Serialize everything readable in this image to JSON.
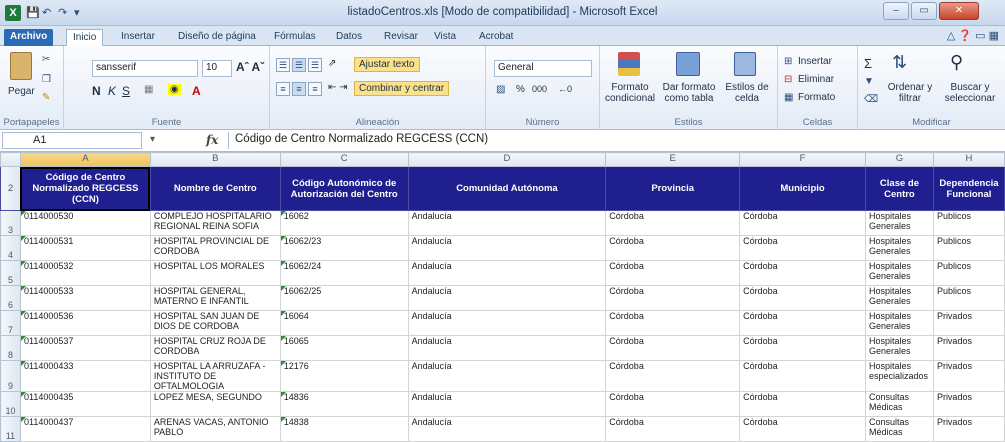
{
  "window": {
    "title": "listadoCentros.xls  [Modo de compatibilidad] - Microsoft Excel",
    "app_letter": "X",
    "controls": [
      "–",
      "▭",
      "✕"
    ]
  },
  "tabs": [
    {
      "label": "Archivo"
    },
    {
      "label": "Inicio"
    },
    {
      "label": "Insertar"
    },
    {
      "label": "Diseño de página"
    },
    {
      "label": "Fórmulas"
    },
    {
      "label": "Datos"
    },
    {
      "label": "Revisar"
    },
    {
      "label": "Vista"
    },
    {
      "label": "Acrobat"
    }
  ],
  "ribbon": {
    "clipboard": {
      "paste": "Pegar",
      "label": "Portapapeles"
    },
    "font": {
      "name": "sansserif",
      "size": "10",
      "label": "Fuente"
    },
    "alignment": {
      "wrap": "Ajustar texto",
      "merge": "Combinar y centrar",
      "label": "Alineación"
    },
    "number": {
      "format": "General",
      "label": "Número"
    },
    "styles": {
      "cond": "Formato condicional",
      "table": "Dar formato como tabla",
      "cell": "Estilos de celda",
      "label": "Estilos"
    },
    "cells": {
      "insert": "Insertar",
      "delete": "Eliminar",
      "format": "Formato",
      "label": "Celdas"
    },
    "editing": {
      "sort": "Ordenar y filtrar",
      "find": "Buscar y seleccionar",
      "label": "Modificar"
    }
  },
  "formula_bar": {
    "name_box": "A1",
    "fx": "fx",
    "content": "Código de Centro Normalizado REGCESS (CCN)"
  },
  "columns": [
    "A",
    "B",
    "C",
    "D",
    "E",
    "F",
    "G",
    "H"
  ],
  "header_row": {
    "row_num": "2",
    "cells": [
      "Código de Centro Normalizado REGCESS (CCN)",
      "Nombre de Centro",
      "Código Autonómico de Autorización del Centro",
      "Comunidad Autónoma",
      "Provincia",
      "Municipio",
      "Clase de Centro",
      "Dependencia Funcional"
    ]
  },
  "rows": [
    {
      "n": "3",
      "c": [
        "0114000530",
        "COMPLEJO HOSPITALARIO REGIONAL REINA SOFIA",
        "16062",
        "Andalucía",
        "Córdoba",
        "Córdoba",
        "Hospitales Generales",
        "Publicos"
      ]
    },
    {
      "n": "4",
      "c": [
        "0114000531",
        "HOSPITAL PROVINCIAL DE CORDOBA",
        "16062/23",
        "Andalucía",
        "Córdoba",
        "Córdoba",
        "Hospitales Generales",
        "Publicos"
      ]
    },
    {
      "n": "5",
      "c": [
        "0114000532",
        "HOSPITAL LOS MORALES",
        "16062/24",
        "Andalucía",
        "Córdoba",
        "Córdoba",
        "Hospitales Generales",
        "Publicos"
      ]
    },
    {
      "n": "6",
      "c": [
        "0114000533",
        "HOSPITAL GENERAL, MATERNO E INFANTIL",
        "16062/25",
        "Andalucía",
        "Córdoba",
        "Córdoba",
        "Hospitales Generales",
        "Publicos"
      ]
    },
    {
      "n": "7",
      "c": [
        "0114000536",
        "HOSPITAL SAN JUAN DE DIOS DE CORDOBA",
        "16064",
        "Andalucía",
        "Córdoba",
        "Córdoba",
        "Hospitales Generales",
        "Privados"
      ]
    },
    {
      "n": "8",
      "c": [
        "0114000537",
        "HOSPITAL CRUZ ROJA DE CORDOBA",
        "16065",
        "Andalucía",
        "Córdoba",
        "Córdoba",
        "Hospitales Generales",
        "Privados"
      ]
    },
    {
      "n": "9",
      "c": [
        "0114000433",
        "HOSPITAL LA ARRUZAFA - INSTITUTO DE OFTALMOLOGIA",
        "12176",
        "Andalucía",
        "Córdoba",
        "Córdoba",
        "Hospitales especializados",
        "Privados"
      ]
    },
    {
      "n": "10",
      "c": [
        "0114000435",
        "LOPEZ MESA, SEGUNDO",
        "14836",
        "Andalucía",
        "Córdoba",
        "Córdoba",
        "Consultas Médicas",
        "Privados"
      ]
    },
    {
      "n": "11",
      "c": [
        "0114000437",
        "ARENAS VACAS, ANTONIO PABLO",
        "14838",
        "Andalucía",
        "Córdoba",
        "Córdoba",
        "Consultas Médicas",
        "Privados"
      ]
    }
  ]
}
